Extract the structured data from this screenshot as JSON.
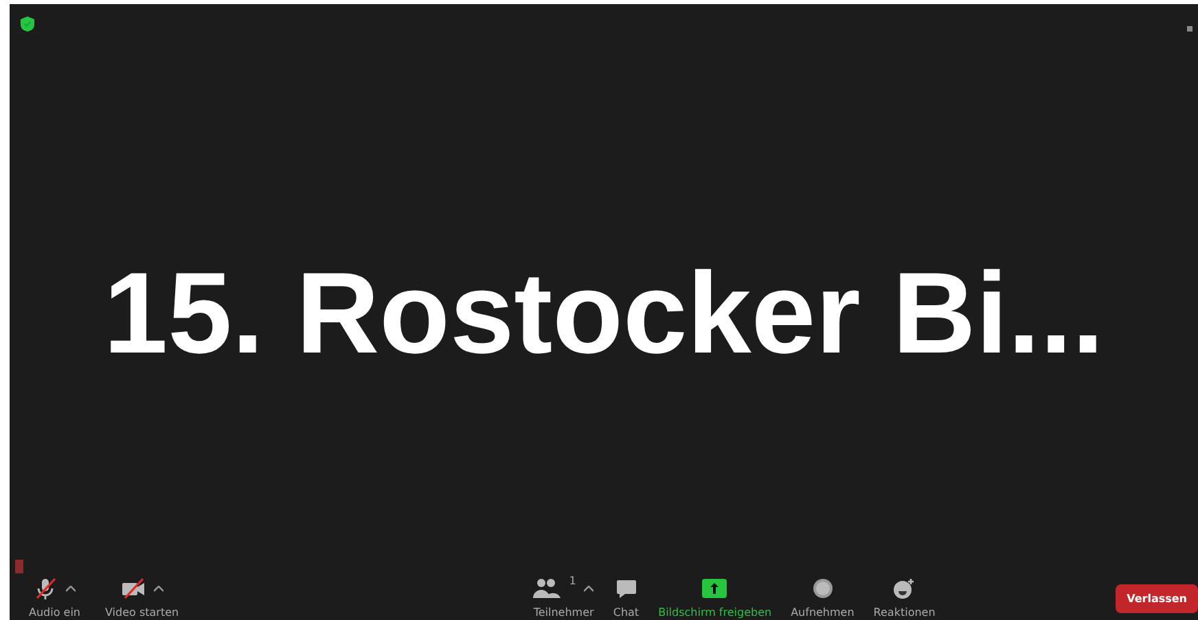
{
  "meeting": {
    "display_text": "15. Rostocker Bi..."
  },
  "toolbar": {
    "left": [
      {
        "kind": "audio",
        "label": "Audio ein",
        "muted": true
      },
      {
        "kind": "video",
        "label": "Video starten",
        "muted": true
      }
    ],
    "center": [
      {
        "kind": "participants",
        "label": "Teilnehmer",
        "count": "1"
      },
      {
        "kind": "chat",
        "label": "Chat"
      },
      {
        "kind": "share",
        "label": "Bildschirm freigeben"
      },
      {
        "kind": "record",
        "label": "Aufnehmen"
      },
      {
        "kind": "reactions",
        "label": "Reaktionen"
      }
    ],
    "leave_button": "Verlassen"
  }
}
